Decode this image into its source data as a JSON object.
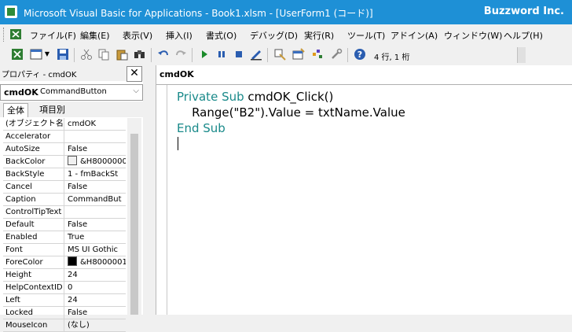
{
  "window": {
    "title": "Microsoft Visual Basic for Applications - Book1.xlsm - [UserForm1 (コード)]",
    "brand": "Buzzword Inc."
  },
  "menu": [
    "ファイル(F)",
    "編集(E)",
    "表示(V)",
    "挿入(I)",
    "書式(O)",
    "デバッグ(D)",
    "実行(R)",
    "ツール(T)",
    "アドイン(A)",
    "ウィンドウ(W)",
    "ヘルプ(H)"
  ],
  "toolbar": {
    "position": "4 行, 1 桁",
    "icons": [
      "excel-icon",
      "insert-userform-icon",
      "save-icon",
      "cut-icon",
      "copy-icon",
      "paste-icon",
      "find-icon",
      "undo-icon",
      "redo-icon",
      "run-icon",
      "break-icon",
      "reset-icon",
      "design-mode-icon",
      "project-explorer-icon",
      "properties-icon",
      "object-browser-icon",
      "toolbox-icon",
      "help-icon"
    ]
  },
  "properties": {
    "title": "プロパティ - cmdOK",
    "object_name": "cmdOK",
    "object_type": "CommandButton",
    "tabs": [
      "全体",
      "項目別"
    ],
    "rows": [
      {
        "name": "(オブジェクト名)",
        "value": "cmdOK"
      },
      {
        "name": "Accelerator",
        "value": ""
      },
      {
        "name": "AutoSize",
        "value": "False"
      },
      {
        "name": "BackColor",
        "value": "&H8000000",
        "swatch": "#f0f0f0"
      },
      {
        "name": "BackStyle",
        "value": "1 - fmBackSt"
      },
      {
        "name": "Cancel",
        "value": "False"
      },
      {
        "name": "Caption",
        "value": "CommandBut"
      },
      {
        "name": "ControlTipText",
        "value": ""
      },
      {
        "name": "Default",
        "value": "False"
      },
      {
        "name": "Enabled",
        "value": "True"
      },
      {
        "name": "Font",
        "value": "MS UI Gothic"
      },
      {
        "name": "ForeColor",
        "value": "&H8000001",
        "swatch": "#000000"
      },
      {
        "name": "Height",
        "value": "24"
      },
      {
        "name": "HelpContextID",
        "value": "0"
      },
      {
        "name": "Left",
        "value": "24"
      },
      {
        "name": "Locked",
        "value": "False"
      },
      {
        "name": "MouseIcon",
        "value": "(なし)"
      }
    ]
  },
  "code": {
    "procedure": "cmdOK",
    "line1_kw": "Private Sub",
    "line1_rest": " cmdOK_Click()",
    "line2": "    Range(\"B2\").Value = txtName.Value",
    "line3_kw": "End Sub"
  },
  "colors": {
    "titlebar": "#1e90d6",
    "keyword": "#1a8a8a"
  }
}
